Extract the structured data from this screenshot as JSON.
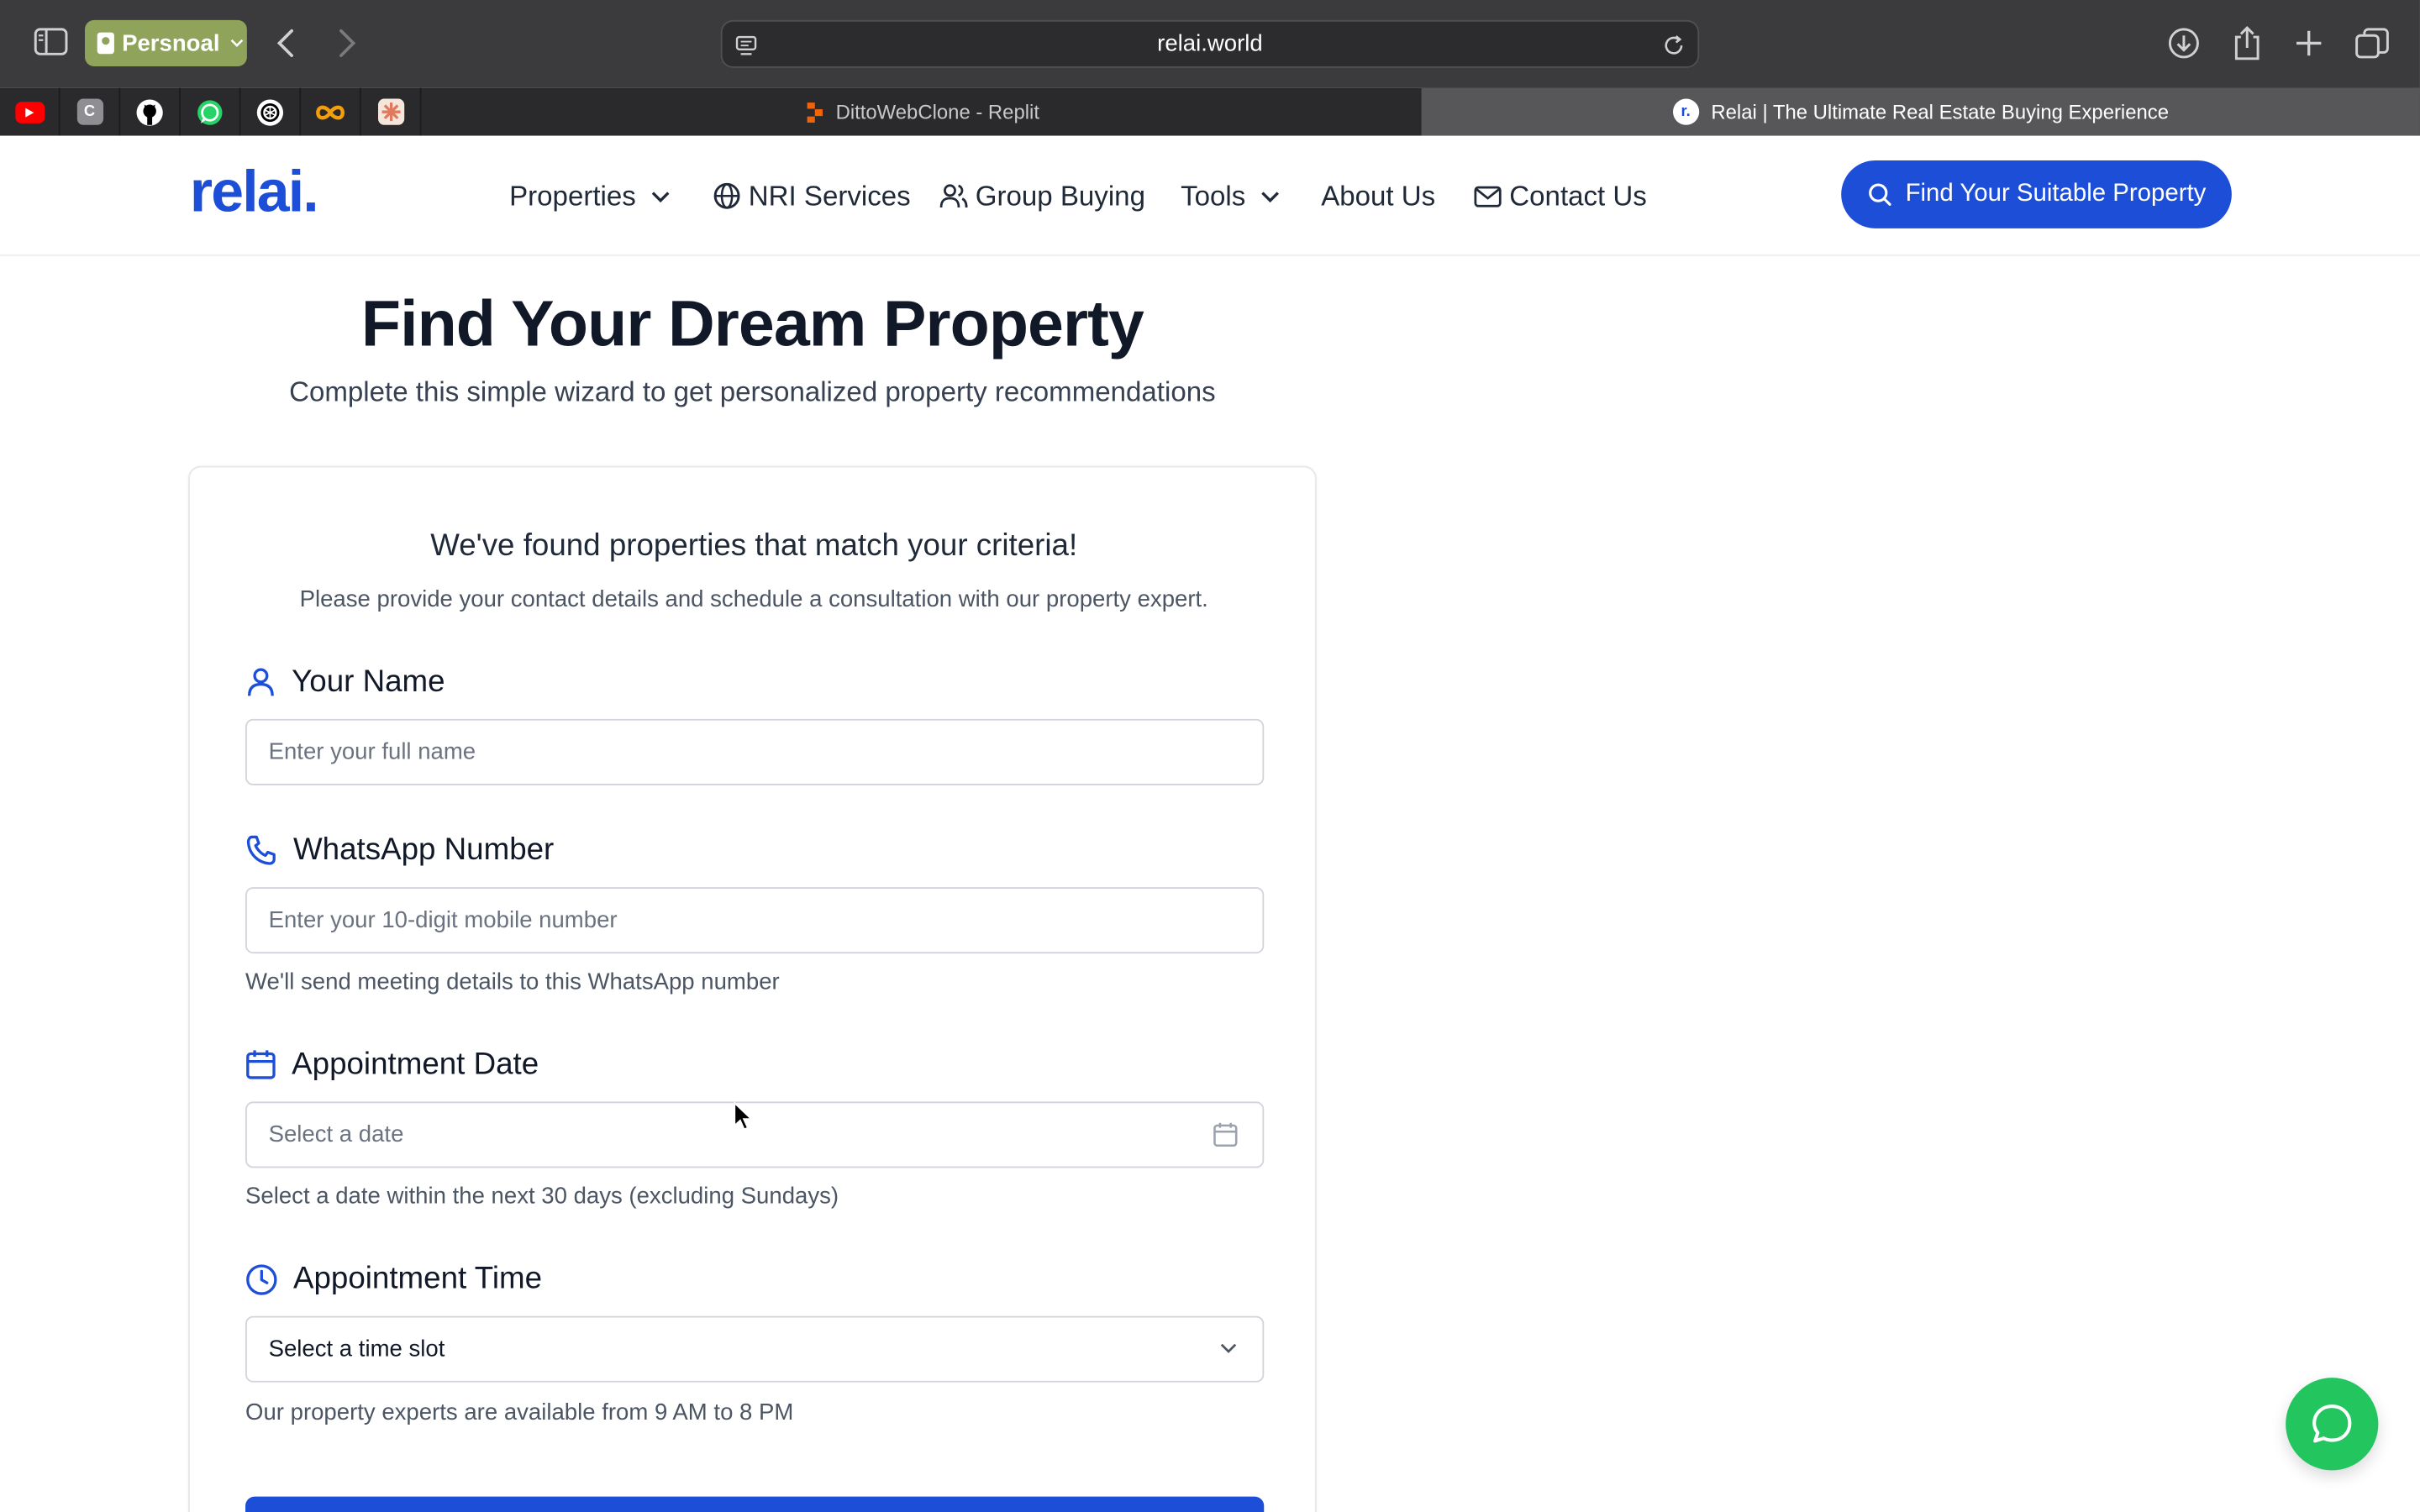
{
  "browser": {
    "profile_label": "Persnoal",
    "url": "relai.world",
    "tabs": [
      {
        "title": "DittoWebClone - Replit",
        "active": false
      },
      {
        "title": "Relai | The Ultimate Real Estate Buying Experience",
        "active": true
      }
    ],
    "pinned_favicons": [
      {
        "icon": "youtube-icon",
        "color": "#ff0000"
      },
      {
        "icon": "c-app-icon",
        "color": "#8e8e93",
        "glyph": "C"
      },
      {
        "icon": "github-icon",
        "color": "#000000"
      },
      {
        "icon": "whatsapp-icon",
        "color": "#25d366"
      },
      {
        "icon": "openai-icon",
        "color": "#000000"
      },
      {
        "icon": "infinity-icon",
        "color": "#f59e0b"
      },
      {
        "icon": "claude-icon",
        "color": "#e07a5f"
      }
    ]
  },
  "site": {
    "logo": "relai.",
    "nav": {
      "properties": "Properties",
      "nri_services": "NRI Services",
      "group_buying": "Group Buying",
      "tools": "Tools",
      "about_us": "About Us",
      "contact_us": "Contact Us"
    },
    "cta_label": "Find Your Suitable Property",
    "accent_color": "#1d4ed8"
  },
  "hero": {
    "title": "Find Your Dream Property",
    "subtitle": "Complete this simple wizard to get personalized property recommendations"
  },
  "form": {
    "heading": "We've found properties that match your criteria!",
    "subheading": "Please provide your contact details and schedule a consultation with our property expert.",
    "name": {
      "label": "Your Name",
      "placeholder": "Enter your full name"
    },
    "whatsapp": {
      "label": "WhatsApp Number",
      "placeholder": "Enter your 10-digit mobile number",
      "help": "We'll send meeting details to this WhatsApp number"
    },
    "date": {
      "label": "Appointment Date",
      "placeholder": "Select a date",
      "help": "Select a date within the next 30 days (excluding Sundays)"
    },
    "time": {
      "label": "Appointment Time",
      "selected": "Select a time slot",
      "help": "Our property experts are available from 9 AM to 8 PM"
    }
  },
  "chat_widget_color": "#22c55e"
}
